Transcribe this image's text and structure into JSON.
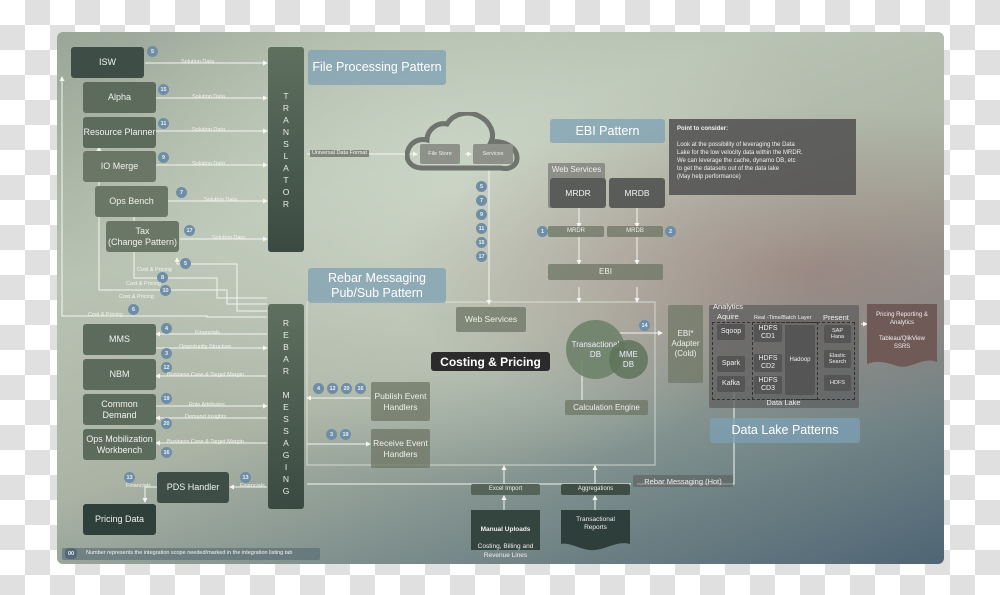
{
  "titles": {
    "file_processing": "File Processing Pattern",
    "rebar_messaging": "Rebar Messaging\nPub/Sub Pattern",
    "ebi_pattern": "EBI Pattern",
    "data_lake_patterns": "Data Lake Patterns",
    "costing_pricing": "Costing & Pricing"
  },
  "translator": {
    "letters": [
      "T",
      "R",
      "A",
      "N",
      "S",
      "L",
      "A",
      "T",
      "O",
      "R"
    ]
  },
  "rebar": {
    "letters": [
      "R",
      "E",
      "B",
      "A",
      "R",
      "",
      "M",
      "E",
      "S",
      "S",
      "A",
      "G",
      "I",
      "N",
      "G"
    ]
  },
  "left_systems_top": [
    {
      "name": "ISW",
      "badge": "5",
      "flow": "Solution Data"
    },
    {
      "name": "Alpha",
      "badge": "15",
      "flow": "Solution Data"
    },
    {
      "name": "Resource Planner",
      "badge": "11",
      "flow": "Solution Data"
    },
    {
      "name": "IO Merge",
      "badge": "9",
      "flow": "Solution Data"
    },
    {
      "name": "Ops Bench",
      "badge": "7",
      "flow": "Solution Data"
    },
    {
      "name": "Tax\n(Change Pattern)",
      "badge": "17",
      "flow": "Solution Data"
    }
  ],
  "cost_pricing_flows": [
    {
      "label": "Cost & Pricing",
      "badge": "5"
    },
    {
      "label": "Cost & Pricing",
      "badge": "8"
    },
    {
      "label": "Cost & Pricing",
      "badge": "10"
    },
    {
      "label": "Cost & Pricing",
      "badge": "6"
    }
  ],
  "left_systems_bottom": [
    {
      "name": "MMS",
      "flows": [
        {
          "label": "Financials",
          "badge": "4",
          "dir": "in"
        },
        {
          "label": "Opportunity Structure",
          "badge": "3",
          "dir": "out"
        }
      ]
    },
    {
      "name": "NBM",
      "flows": [
        {
          "label": "Business Case & Target Margin",
          "badge": "12",
          "dir": "in"
        }
      ]
    },
    {
      "name": "Common Demand",
      "flows": [
        {
          "label": "Role Attributes",
          "badge": "19",
          "dir": "out"
        },
        {
          "label": "Demand Insights",
          "badge": "20",
          "dir": "in"
        }
      ]
    },
    {
      "name": "Ops Mobilization\nWorkbench",
      "flows": [
        {
          "label": "Business Case & Target Margin",
          "badge": "16",
          "dir": "in"
        }
      ]
    }
  ],
  "pds": {
    "handler": "PDS Handler",
    "pricing_data": "Pricing Data",
    "flow_in": {
      "label": "Financials",
      "badge": "13"
    },
    "flow_out": {
      "label": "Financials",
      "badge": "13"
    }
  },
  "legend": {
    "badge": "00",
    "text": "Number represents the integration scope needed/marked in the integration listing tab"
  },
  "cloud": {
    "input_label": "Universal Data Format",
    "file_store": "File Store",
    "services": "Services",
    "badges": [
      "5",
      "7",
      "9",
      "11",
      "15",
      "17"
    ]
  },
  "costing": {
    "web_services": "Web Services",
    "publish": "Publish Event\nHandlers",
    "publish_badges": [
      "4",
      "12",
      "20",
      "16"
    ],
    "receive": "Receive Event\nHandlers",
    "receive_badges": [
      "3",
      "19"
    ],
    "transactional_db": "Transactional\nDB",
    "mme_db": "MME\nDB",
    "calc_engine": "Calculation Engine",
    "db_out_badge": "14"
  },
  "ebi": {
    "web_services_label": "Web Services",
    "mrdr": "MRDR",
    "mrdb": "MRDB",
    "mrdr_bar": "MRDR",
    "mrdb_bar": "MRDB",
    "mrdr_badge": "1",
    "mrdb_badge": "2",
    "ebi": "EBI"
  },
  "note": {
    "title": "Point to consider:",
    "lines": [
      "Look at the possibility of leveraging the Data",
      "Lake for the low velocity data within the MRDR.",
      "We can leverage the cache, dynamo DB, etc",
      "to get the datasets out of the data lake",
      "(May help performance)"
    ]
  },
  "analytics": {
    "adapter": "EBI*\nAdapter\n(Cold)",
    "title": "Analytics",
    "aquire": "Aquire",
    "realtime": "Real -Time/Batch Layer",
    "present": "Present",
    "sqoop": "Sqoop",
    "spark": "Spark",
    "kafka": "Kafka",
    "hdfs_cd1": "HDFS\nCD1",
    "hdfs_cd2": "HDFS\nCD2",
    "hdfs_cd3": "HDFS\nCD3",
    "hadoop": "Hadoop",
    "sap_hana": "SAP\nHana",
    "elastic": "Elastic\nSearch",
    "hdfs": "HDFS",
    "data_lake": "Data Lake"
  },
  "reporting": {
    "title": "Pricing Reporting &\nAnalytics",
    "tools": "Tableau/QlikView\nSSRS"
  },
  "bottom": {
    "excel_import": "Excel Import",
    "aggregations": "Aggregations",
    "manual_uploads_title": "Manual Uploads",
    "manual_uploads_text": "Costing, Billing and\nRevenue Lines",
    "transactional_reports": "Transactional\nReports",
    "rebar_hot": "Rebar Messaging (Hot)"
  }
}
